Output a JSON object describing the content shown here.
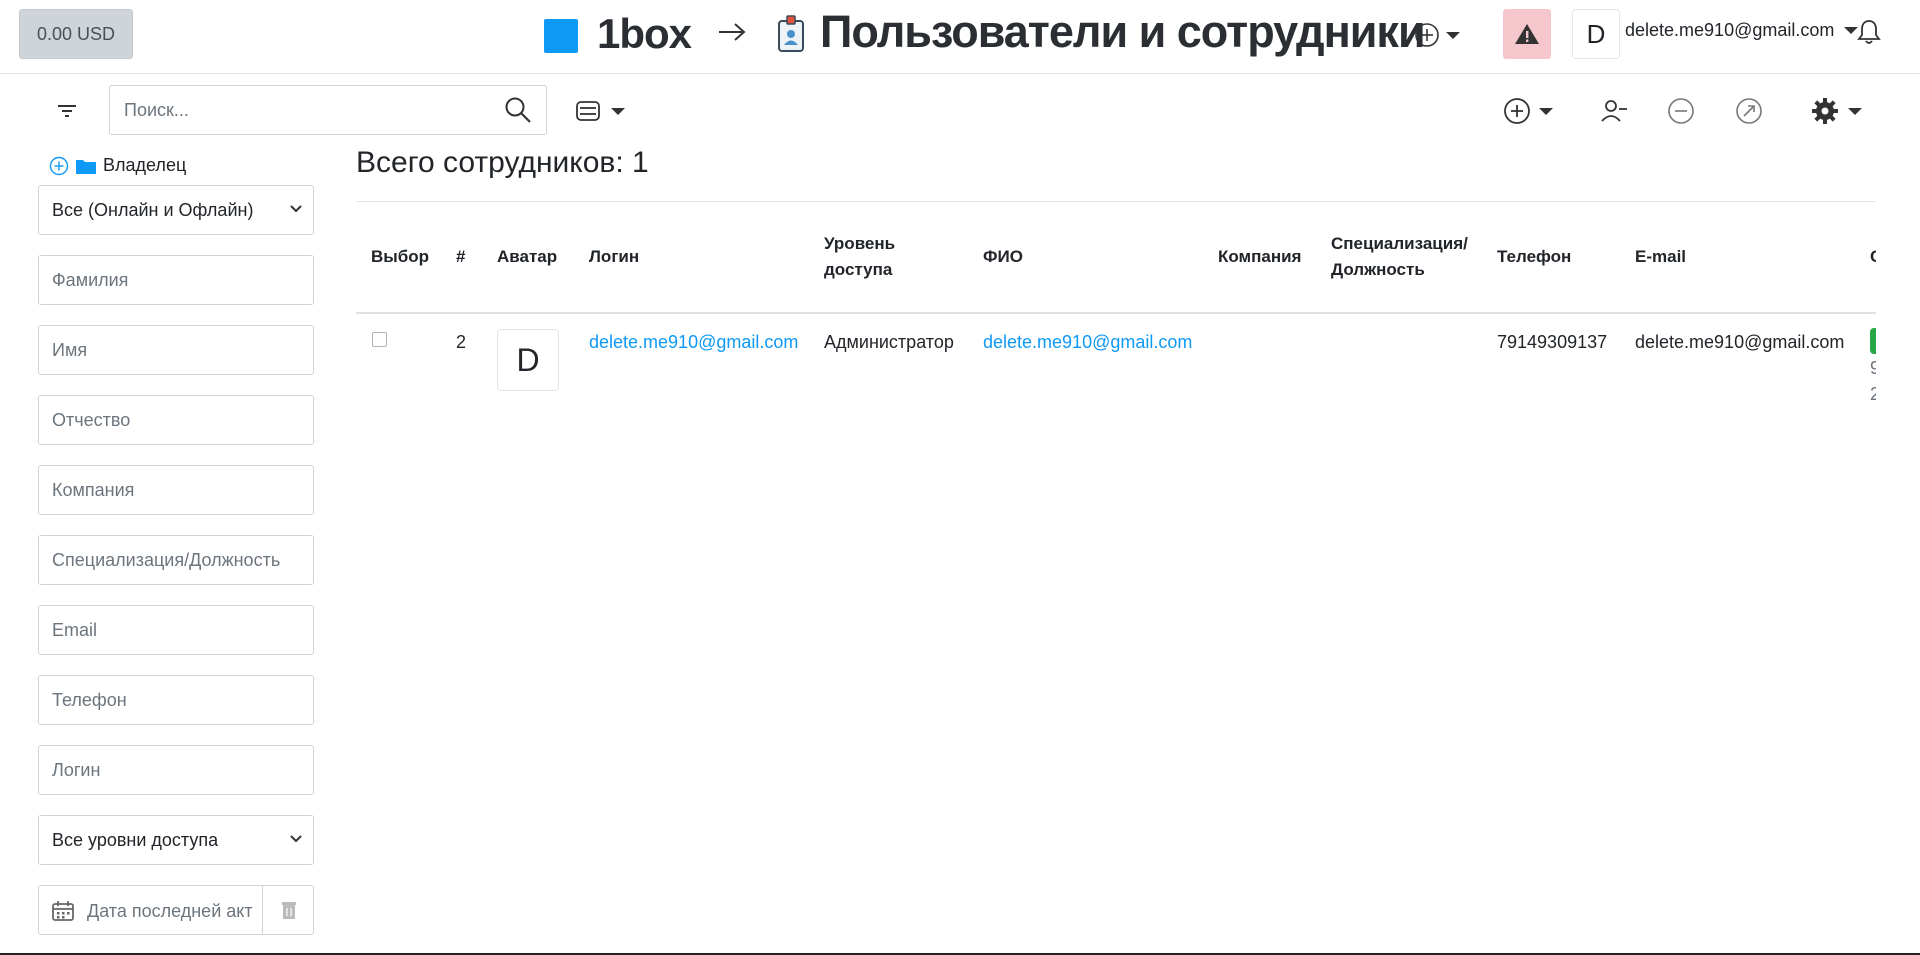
{
  "header": {
    "balance": "0.00 USD",
    "logo_text": "1box",
    "page_title": "Пользователи и сотрудники",
    "user_initial": "D",
    "user_email": "delete.me910@gmail.com",
    "brand_color": "#0d99f5",
    "warning_color": "#f5c6cb",
    "icons": [
      "arrow-right-icon",
      "id-badge-icon",
      "plus-circle-icon",
      "warning-icon",
      "bell-icon"
    ]
  },
  "toolbar": {
    "search_placeholder": "Поиск...",
    "icons": [
      "filter-icon",
      "search-icon",
      "view-toggle-icon",
      "add-icon",
      "user-minus-icon",
      "minus-circle-icon",
      "share-icon",
      "gear-icon"
    ]
  },
  "sidebar": {
    "owner_label": "Владелец",
    "status_select": "Все (Онлайн и Офлайн)",
    "fields": [
      {
        "placeholder": "Фамилия"
      },
      {
        "placeholder": "Имя"
      },
      {
        "placeholder": "Отчество"
      },
      {
        "placeholder": "Компания"
      },
      {
        "placeholder": "Специализация/Должность"
      },
      {
        "placeholder": "Email"
      },
      {
        "placeholder": "Телефон"
      },
      {
        "placeholder": "Логин"
      }
    ],
    "access_select": "Все уровни доступа",
    "date_placeholder": "Дата последней акт"
  },
  "main": {
    "total_label": "Всего сотрудников: 1",
    "columns": [
      "Выбор",
      "#",
      "Аватар",
      "Логин",
      "Уровень доступа",
      "ФИО",
      "Компания",
      "Специализация/ Должность",
      "Телефон",
      "E-mail",
      "С"
    ],
    "rows": [
      {
        "num": "2",
        "avatar": "D",
        "login": "delete.me910@gmail.com",
        "access": "Администратор",
        "fio": "delete.me910@gmail.com",
        "company": "",
        "position": "",
        "phone": "79149309137",
        "email": "delete.me910@gmail.com",
        "cut_1": "9",
        "cut_2": "2"
      }
    ]
  }
}
